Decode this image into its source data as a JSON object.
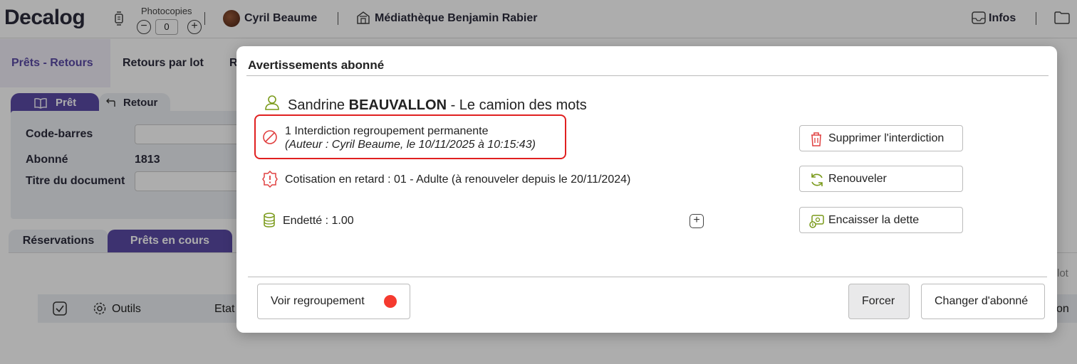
{
  "app": {
    "logo_text": "Decalog",
    "photocopies_label": "Photocopies",
    "photocopies_value": "0",
    "minus_symbol": "−",
    "plus_symbol": "+",
    "user_name": "Cyril Beaume",
    "library_name": "Médiathèque Benjamin Rabier",
    "infos_label": "Infos"
  },
  "main_tabs": [
    {
      "label": "Prêts - Retours"
    },
    {
      "label": "Retours par lot"
    },
    {
      "label": "R"
    }
  ],
  "loan_panel": {
    "tab_pret": "Prêt",
    "tab_retour": "Retour",
    "barcode_label": "Code-barres",
    "patron_label": "Abonné",
    "patron_value": "1813",
    "title_label": "Titre du document"
  },
  "lower_tabs": {
    "reservations": "Réservations",
    "prets_en_cours": "Prêts en cours"
  },
  "toolbar": {
    "outils": "Outils",
    "etat": "Etat",
    "right_fragment_1": "lot",
    "right_fragment_2": "on"
  },
  "modal": {
    "title": "Avertissements abonné",
    "patron_first": "Sandrine",
    "patron_last": "BEAUVALLON",
    "patron_group": " - Le camion des mots",
    "interdiction_text": "1 Interdiction regroupement permanente",
    "interdiction_author": "(Auteur : Cyril Beaume, le 10/11/2025 à 10:15:43)",
    "cotisation_text": "Cotisation en retard : 01 - Adulte (à renouveler depuis le 20/11/2024)",
    "dette_text": "Endetté : 1.00",
    "btn_supprimer": "Supprimer l'interdiction",
    "btn_renouveler": "Renouveler",
    "btn_encaisser": "Encaisser la dette",
    "btn_voir": "Voir regroupement",
    "btn_forcer": "Forcer",
    "btn_changer": "Changer d'abonné"
  },
  "colors": {
    "accent": "#5b4aa6",
    "alert_red": "#e02020",
    "dot_red": "#f53a2f",
    "icon_green": "#7a9a1a"
  }
}
